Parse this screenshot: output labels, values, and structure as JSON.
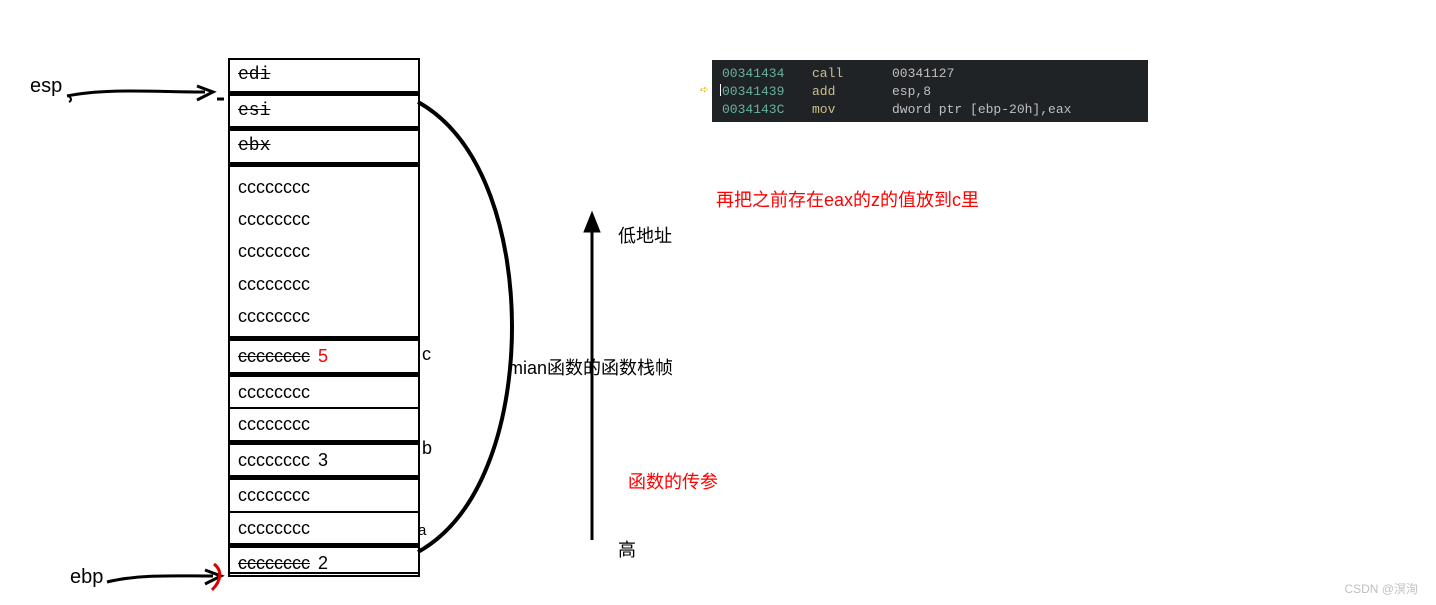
{
  "pointers": {
    "esp": "esp",
    "ebp": "ebp"
  },
  "stack": {
    "registers": [
      "edi",
      "esi",
      "ebx"
    ],
    "cc_block_top": [
      "cccccccc",
      "cccccccc",
      "cccccccc",
      "cccccccc",
      "cccccccc"
    ],
    "row_c": {
      "text": "cccccccc",
      "value": "5",
      "label": "c"
    },
    "mid1": "cccccccc",
    "mid2": "cccccccc",
    "row_b": {
      "text": "cccccccc",
      "value": "3",
      "label": "b"
    },
    "mid3": "cccccccc",
    "mid4": "cccccccc",
    "row_a": {
      "text": "cccccccc",
      "value": "2",
      "label": "a"
    }
  },
  "arrow_labels": {
    "low": "低地址",
    "high": "高"
  },
  "bracket_label": "mian函数的函数栈帧",
  "red_notes": {
    "eax_to_c": "再把之前存在eax的z的值放到c里",
    "param": "函数的传参"
  },
  "asm": [
    {
      "addr": "00341434",
      "op": "call",
      "args": "00341127"
    },
    {
      "addr": "00341439",
      "op": "add",
      "args": "esp,8"
    },
    {
      "addr": "0034143C",
      "op": "mov",
      "args": "dword ptr [ebp-20h],eax"
    }
  ],
  "watermark": "CSDN @溟洵"
}
